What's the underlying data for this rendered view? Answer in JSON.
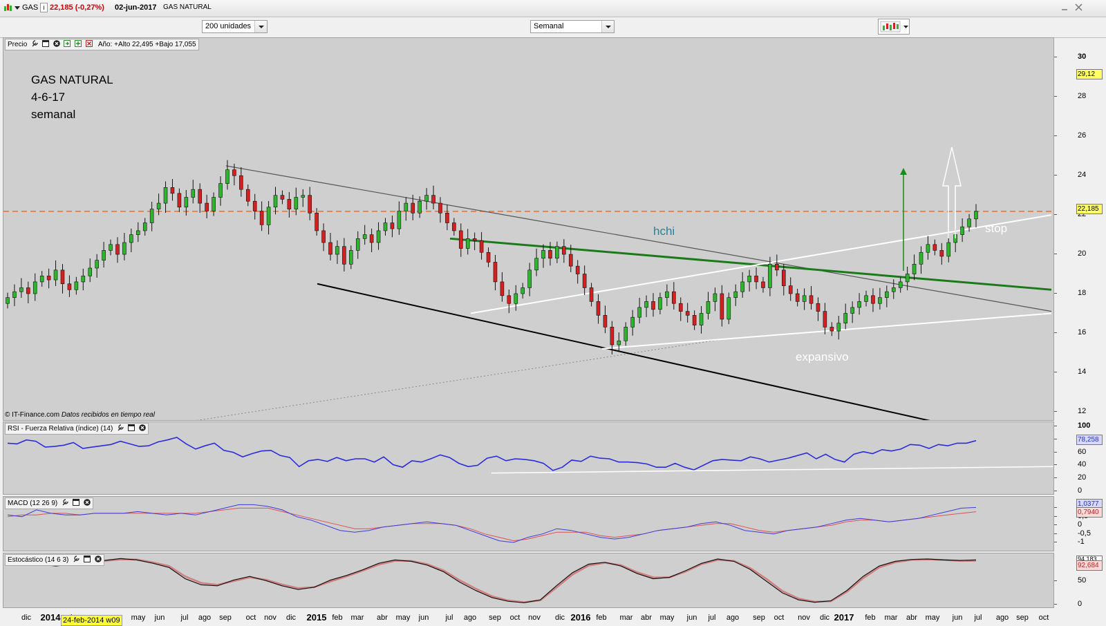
{
  "titlebar": {
    "symbol": "GAS",
    "info_icon": "i",
    "quote": "22,185 (-0,27%)",
    "date": "02-jun-2017",
    "name": "GAS NATURAL"
  },
  "toolbar": {
    "units_select": "200 unidades",
    "period_select": "Semanal"
  },
  "price_panel": {
    "label": "Precio",
    "year_stats": "Año: +Alto 22,495 +Bajo 17,055",
    "chart_title": "GAS NATURAL",
    "chart_date": "4-6-17",
    "chart_period": "semanal",
    "copyright": "© IT-Finance.com",
    "realtime_note": "Datos recibidos en tiempo real",
    "annotation_hchi": "hchi",
    "annotation_stop": "stop",
    "annotation_expansivo": "expansivo",
    "last_badge": "22,185",
    "high_badge": "29,12",
    "accent_color": "#ff6a1a",
    "bull_color": "#2db62d",
    "bear_color": "#d42020"
  },
  "rsi_panel": {
    "label": "RSI - Fuerza Relativa (índice) (14)",
    "badge": "78,258"
  },
  "macd_panel": {
    "label": "MACD (12 26 9)",
    "badge_macd": "1,0377",
    "badge_signal": "0,7940"
  },
  "stoch_panel": {
    "label": "Estocástico (14 6 3)",
    "badge_k": "94,183",
    "badge_d": "92,684"
  },
  "x_axis": {
    "cursor_label": "24-feb-2014 w09",
    "ticks": [
      "dic",
      "2014",
      "br",
      "may",
      "jun",
      "jul",
      "ago",
      "sep",
      "oct",
      "nov",
      "dic",
      "2015",
      "feb",
      "mar",
      "abr",
      "may",
      "jun",
      "jul",
      "ago",
      "sep",
      "oct",
      "nov",
      "dic",
      "2016",
      "feb",
      "mar",
      "abr",
      "may",
      "jun",
      "jul",
      "ago",
      "sep",
      "oct",
      "nov",
      "dic",
      "2017",
      "feb",
      "mar",
      "abr",
      "may",
      "jun",
      "jul",
      "ago",
      "sep",
      "oct"
    ]
  },
  "chart_data": [
    {
      "type": "candlestick",
      "ylim": [
        11.5,
        31
      ],
      "yticks": [
        12,
        14,
        16,
        18,
        20,
        22,
        24,
        26,
        28,
        30
      ],
      "reference_line": 22.185,
      "closes": [
        17.8,
        18.1,
        18.3,
        18.0,
        18.6,
        18.9,
        18.7,
        19.2,
        18.5,
        18.2,
        18.6,
        18.9,
        19.3,
        19.7,
        20.2,
        20.5,
        20.0,
        20.6,
        21.0,
        21.2,
        21.6,
        22.3,
        22.6,
        23.4,
        23.1,
        22.4,
        22.9,
        23.3,
        22.6,
        22.2,
        22.9,
        23.6,
        24.3,
        24.0,
        23.3,
        22.7,
        22.2,
        21.5,
        22.4,
        23.0,
        22.8,
        22.3,
        22.9,
        23.0,
        22.1,
        21.2,
        20.6,
        20.0,
        20.4,
        19.5,
        20.2,
        20.8,
        21.0,
        20.6,
        21.2,
        21.6,
        21.3,
        22.2,
        22.6,
        22.1,
        22.7,
        23.0,
        22.6,
        22.1,
        21.6,
        21.2,
        20.3,
        20.8,
        20.7,
        20.1,
        19.6,
        18.6,
        17.9,
        17.5,
        18.0,
        18.3,
        19.2,
        19.8,
        20.2,
        19.8,
        20.4,
        20.0,
        19.4,
        19.0,
        18.3,
        17.6,
        16.9,
        16.3,
        15.4,
        15.6,
        16.3,
        16.8,
        17.3,
        17.6,
        17.2,
        17.8,
        18.1,
        17.5,
        17.1,
        16.9,
        16.4,
        17.0,
        17.6,
        18.0,
        16.7,
        17.8,
        18.1,
        18.6,
        18.9,
        18.6,
        18.3,
        19.5,
        19.2,
        18.4,
        18.0,
        17.6,
        17.9,
        17.5,
        17.1,
        16.3,
        16.1,
        16.5,
        17.0,
        17.3,
        17.6,
        17.9,
        17.5,
        17.8,
        18.1,
        18.3,
        18.6,
        19.0,
        19.5,
        20.1,
        20.5,
        20.2,
        19.9,
        20.6,
        21.0,
        21.4,
        21.8,
        22.185
      ],
      "trendlines": [
        {
          "color": "#555555",
          "from": [
            "2014-sep",
            24.5
          ],
          "to": [
            "2017-oct",
            17.1
          ]
        },
        {
          "color": "#000000",
          "from": [
            "2015-ene",
            18.5
          ],
          "to": [
            "2017-jun",
            11.5
          ]
        },
        {
          "color": "#1a7a1a",
          "from": [
            "2015-jul",
            20.8
          ],
          "to": [
            "2017-oct",
            18.2
          ]
        },
        {
          "color": "#ffffff",
          "from": [
            "2015-ago",
            17.0
          ],
          "to": [
            "2017-oct",
            22.0
          ]
        },
        {
          "color": "#ffffff",
          "from": [
            "2016-feb",
            15.2
          ],
          "to": [
            "2017-oct",
            17.0
          ]
        }
      ]
    },
    {
      "type": "line",
      "name": "RSI",
      "ylim": [
        0,
        100
      ],
      "yticks": [
        0,
        20,
        40,
        60,
        80,
        100
      ],
      "values": [
        74,
        73,
        79,
        77,
        68,
        69,
        71,
        75,
        66,
        68,
        70,
        72,
        77,
        73,
        69,
        70,
        76,
        79,
        83,
        73,
        65,
        70,
        74,
        63,
        60,
        53,
        58,
        62,
        63,
        55,
        52,
        38,
        47,
        49,
        46,
        52,
        47,
        50,
        50,
        45,
        53,
        41,
        37,
        47,
        45,
        50,
        56,
        52,
        43,
        38,
        40,
        51,
        54,
        47,
        50,
        49,
        47,
        43,
        32,
        37,
        48,
        46,
        54,
        51,
        50,
        45,
        45,
        44,
        42,
        37,
        37,
        43,
        37,
        33,
        40,
        47,
        49,
        48,
        47,
        53,
        50,
        45,
        48,
        51,
        55,
        59,
        50,
        57,
        49,
        45,
        57,
        61,
        58,
        64,
        62,
        65,
        72,
        71,
        66,
        72,
        70,
        74,
        74,
        78
      ]
    },
    {
      "type": "line",
      "name": "MACD",
      "ylim": [
        -1.4,
        1.5
      ],
      "yticks": [
        -1,
        -0.5,
        0,
        0.5,
        1
      ],
      "series": [
        {
          "values": [
            0.6,
            0.5,
            0.9,
            0.7,
            0.6,
            0.6,
            0.7,
            0.7,
            0.7,
            0.8,
            0.7,
            0.6,
            0.7,
            0.6,
            0.8,
            1.0,
            1.2,
            1.2,
            1.1,
            0.9,
            0.5,
            0.3,
            0.0,
            -0.3,
            -0.4,
            -0.3,
            -0.1,
            0.0,
            0.1,
            0.2,
            0.1,
            0.0,
            -0.3,
            -0.6,
            -0.9,
            -1.0,
            -0.7,
            -0.5,
            -0.2,
            -0.3,
            -0.5,
            -0.7,
            -0.8,
            -0.7,
            -0.5,
            -0.3,
            -0.2,
            -0.1,
            0.1,
            0.2,
            0.0,
            -0.3,
            -0.4,
            -0.5,
            -0.3,
            -0.2,
            -0.1,
            0.1,
            0.3,
            0.4,
            0.3,
            0.2,
            0.3,
            0.4,
            0.6,
            0.8,
            1.0,
            1.04
          ]
        },
        {
          "values": [
            0.5,
            0.6,
            0.6,
            0.7,
            0.7,
            0.6,
            0.7,
            0.7,
            0.7,
            0.7,
            0.7,
            0.7,
            0.7,
            0.7,
            0.8,
            0.9,
            1.0,
            1.0,
            1.0,
            0.8,
            0.6,
            0.4,
            0.2,
            0.0,
            -0.2,
            -0.2,
            -0.1,
            0.0,
            0.1,
            0.1,
            0.1,
            0.0,
            -0.2,
            -0.5,
            -0.7,
            -0.9,
            -0.8,
            -0.6,
            -0.4,
            -0.4,
            -0.4,
            -0.6,
            -0.7,
            -0.6,
            -0.5,
            -0.3,
            -0.2,
            -0.1,
            0.0,
            0.1,
            0.1,
            -0.1,
            -0.3,
            -0.4,
            -0.3,
            -0.2,
            -0.1,
            0.0,
            0.2,
            0.3,
            0.3,
            0.2,
            0.3,
            0.4,
            0.5,
            0.6,
            0.7,
            0.79
          ]
        }
      ]
    },
    {
      "type": "line",
      "name": "Estocástico",
      "ylim": [
        0,
        100
      ],
      "yticks": [
        0,
        50
      ],
      "series": [
        {
          "values": [
            94,
            93,
            86,
            82,
            87,
            92,
            94,
            98,
            95,
            88,
            79,
            55,
            42,
            40,
            52,
            60,
            51,
            40,
            32,
            37,
            52,
            62,
            74,
            88,
            95,
            92,
            84,
            70,
            48,
            30,
            15,
            7,
            4,
            10,
            40,
            68,
            86,
            90,
            82,
            66,
            55,
            58,
            72,
            88,
            97,
            92,
            75,
            50,
            25,
            10,
            5,
            8,
            30,
            60,
            82,
            92,
            96,
            97,
            95,
            94,
            95
          ]
        },
        {
          "values": [
            92,
            92,
            88,
            84,
            85,
            90,
            93,
            96,
            96,
            90,
            82,
            60,
            46,
            42,
            50,
            58,
            53,
            43,
            35,
            37,
            49,
            60,
            72,
            85,
            93,
            93,
            86,
            73,
            52,
            34,
            18,
            9,
            5,
            9,
            36,
            64,
            83,
            89,
            84,
            69,
            58,
            58,
            70,
            86,
            95,
            93,
            78,
            55,
            29,
            13,
            6,
            7,
            27,
            56,
            79,
            90,
            95,
            96,
            95,
            93,
            93
          ]
        }
      ]
    }
  ]
}
